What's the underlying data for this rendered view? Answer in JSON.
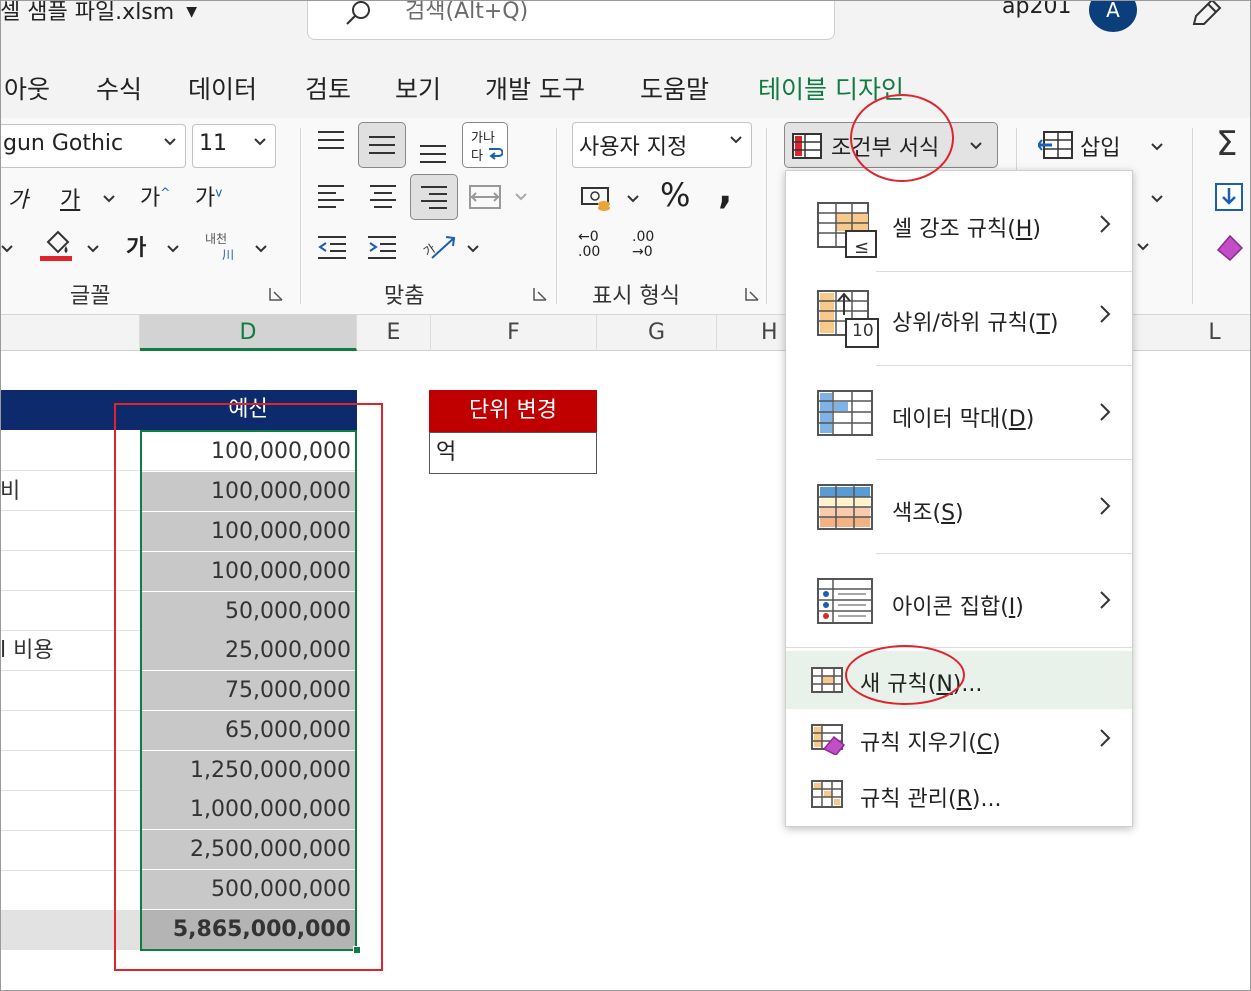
{
  "titlebar": {
    "file_name": "셀 샘플 파일.xlsm",
    "search_placeholder": "검색(Alt+Q)",
    "username": "ap201",
    "avatar_initial": "A"
  },
  "tabs": [
    {
      "label": "아웃"
    },
    {
      "label": "수식"
    },
    {
      "label": "데이터"
    },
    {
      "label": "검토"
    },
    {
      "label": "보기"
    },
    {
      "label": "개발 도구"
    },
    {
      "label": "도움말"
    },
    {
      "label": "테이블 디자인"
    }
  ],
  "ribbon": {
    "font_name": "gun Gothic",
    "font_size": "11",
    "font_glyphs": {
      "italic": "가",
      "underline": "가",
      "grow": "가",
      "shrink": "가",
      "bold": "가",
      "phonetic": "내천",
      "phonetic_sub": "川"
    },
    "wrap_glyph_top": "가나",
    "wrap_glyph_bottom": "다",
    "number_format": "사용자 지정",
    "percent": "%",
    "comma": ",",
    "increase_decimal": "←0 .00",
    "decrease_decimal": ".00 →0",
    "groups": {
      "font": "글꼴",
      "alignment": "맞춤",
      "number": "표시 형식"
    },
    "conditional_format": "조건부 서식",
    "insert": "삽입",
    "sum_glyph": "Σ"
  },
  "columns": [
    "D",
    "E",
    "F",
    "G",
    "H",
    "L"
  ],
  "sheet": {
    "budget_header": "예산",
    "row_labels": [
      "",
      "비",
      "",
      "",
      "",
      "l 비용",
      "",
      "",
      "",
      "",
      "",
      "",
      ""
    ],
    "budget_values": [
      "100,000,000",
      "100,000,000",
      "100,000,000",
      "100,000,000",
      "50,000,000",
      "25,000,000",
      "75,000,000",
      "65,000,000",
      "1,250,000,000",
      "1,000,000,000",
      "2,500,000,000",
      "500,000,000",
      "5,865,000,000"
    ],
    "unit_header": "단위 변경",
    "unit_value": "억"
  },
  "menu": {
    "items": [
      {
        "text": "셀 강조 규칙",
        "key": "H",
        "icon": "highlight-cells-rules-icon"
      },
      {
        "text": "상위/하위 규칙",
        "key": "T",
        "icon": "top-bottom-rules-icon",
        "badge": "10"
      },
      {
        "text": "데이터 막대",
        "key": "D",
        "icon": "data-bars-icon"
      },
      {
        "text": "색조",
        "key": "S",
        "icon": "color-scales-icon"
      },
      {
        "text": "아이콘 집합",
        "key": "I",
        "icon": "icon-sets-icon"
      }
    ],
    "new_rule": {
      "text": "새 규칙",
      "key": "N",
      "suffix": "..."
    },
    "clear_rules": {
      "text": "규칙 지우기",
      "key": "C"
    },
    "manage_rules": {
      "text": "규칙 관리",
      "key": "R",
      "suffix": "..."
    }
  },
  "colors": {
    "excel_green": "#107c41",
    "header_navy": "#0d2a6c",
    "unit_red": "#c00000",
    "annotation_red": "#e0242e"
  }
}
